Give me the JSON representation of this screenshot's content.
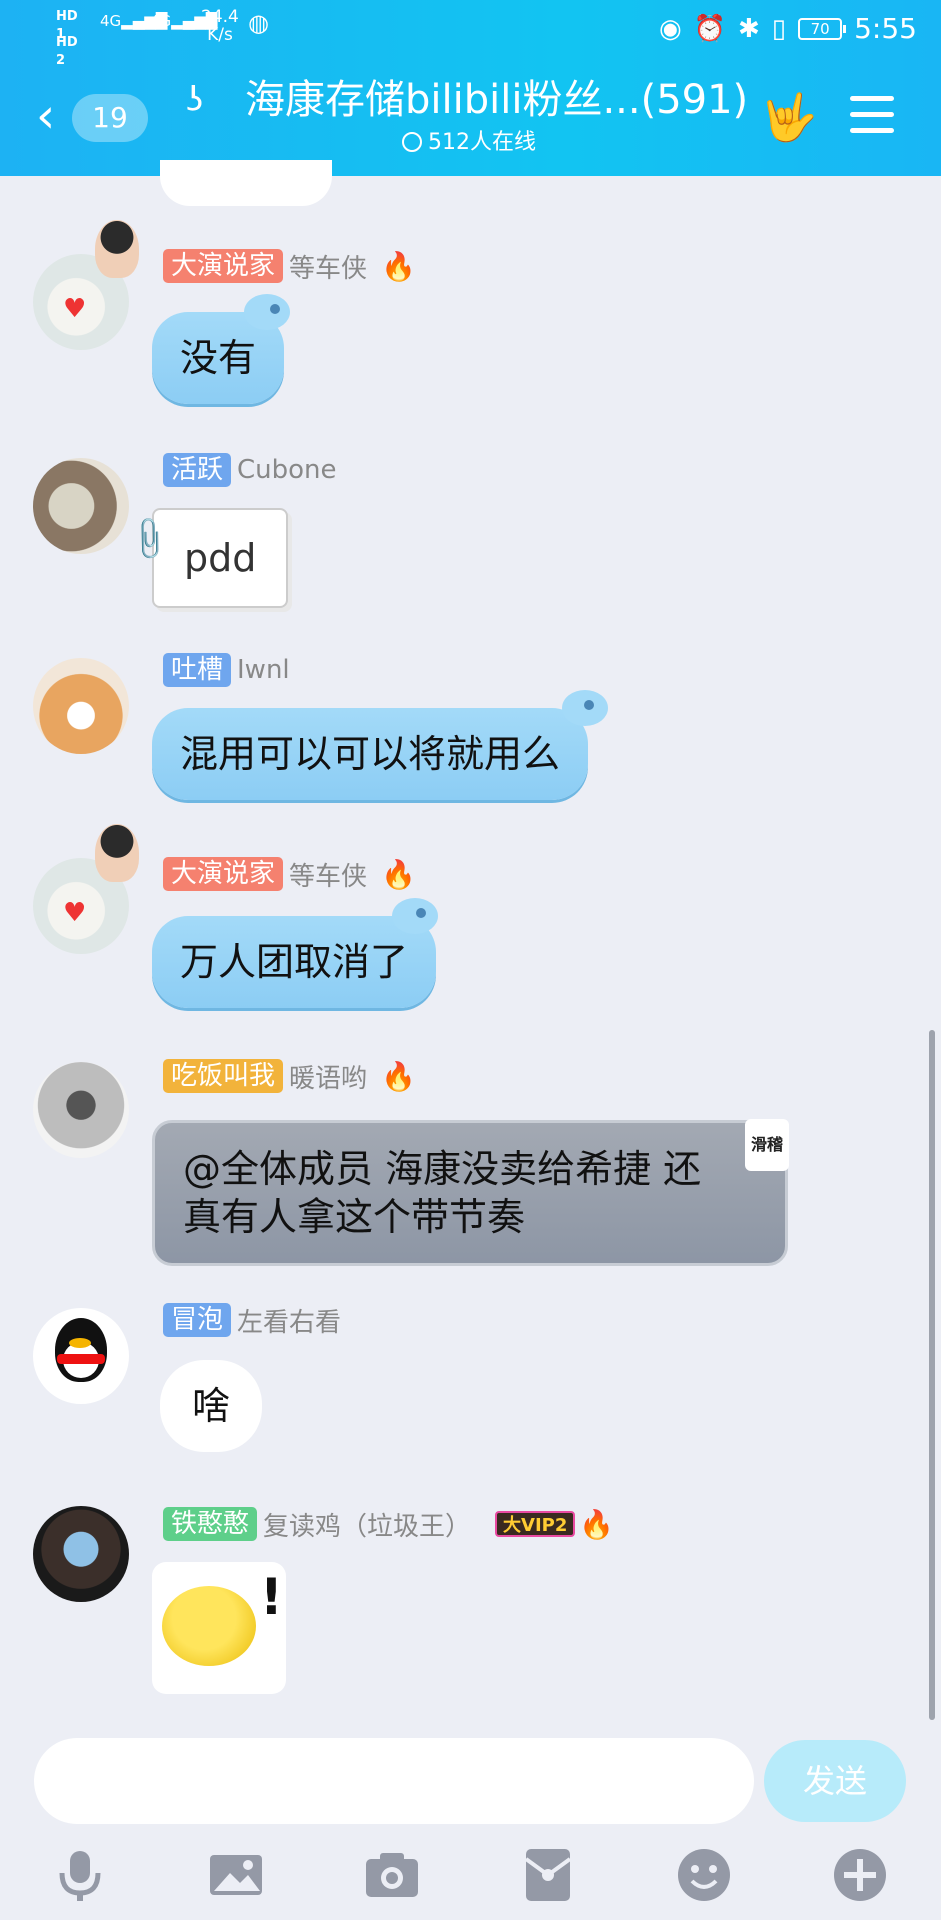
{
  "status_bar": {
    "hd1": "HD 1",
    "hd2": "HD 2",
    "network1": "4G",
    "network2": "4G",
    "speed_value": "24.4",
    "speed_unit": "K/s",
    "battery": "70",
    "time": "5:55"
  },
  "header": {
    "back_label": "<",
    "unread_count": "19",
    "title": "海康存储bilibili粉丝...(591)",
    "online": "512人在线"
  },
  "messages": [
    {
      "badge": "大演说家",
      "badge_color": "#f5816f",
      "nick": "等车侠",
      "fire": true,
      "text": "没有",
      "style": "hippo"
    },
    {
      "badge": "活跃",
      "badge_color": "#6fa6ee",
      "nick": "Cubone",
      "fire": false,
      "text": "pdd",
      "style": "note"
    },
    {
      "badge": "吐槽",
      "badge_color": "#6fa6ee",
      "nick": "Iwnl",
      "fire": false,
      "text": "混用可以可以将就用么",
      "style": "hippo"
    },
    {
      "badge": "大演说家",
      "badge_color": "#f5816f",
      "nick": "等车侠",
      "fire": true,
      "text": "万人团取消了",
      "style": "hippo"
    },
    {
      "badge": "吃饭叫我",
      "badge_color": "#f2b33b",
      "nick": "暖语哟",
      "fire": true,
      "text_line1": "@全体成员  海康没卖给希捷 还",
      "text_line2": "真有人拿这个带节奏",
      "tag": "滑稽",
      "style": "gray"
    },
    {
      "badge": "冒泡",
      "badge_color": "#6fa6ee",
      "nick": "左看右看",
      "fire": false,
      "text": "啥",
      "style": "white"
    },
    {
      "badge": "铁憨憨",
      "badge_color": "#5ecf8a",
      "nick": "复读鸡（垃圾王）",
      "vip": "大VIP2",
      "fire": true,
      "style": "sticker"
    }
  ],
  "input": {
    "placeholder": "",
    "send_label": "发送"
  },
  "toolbar": [
    "microphone-icon",
    "image-icon",
    "camera-icon",
    "red-packet-icon",
    "emoji-icon",
    "plus-icon"
  ]
}
